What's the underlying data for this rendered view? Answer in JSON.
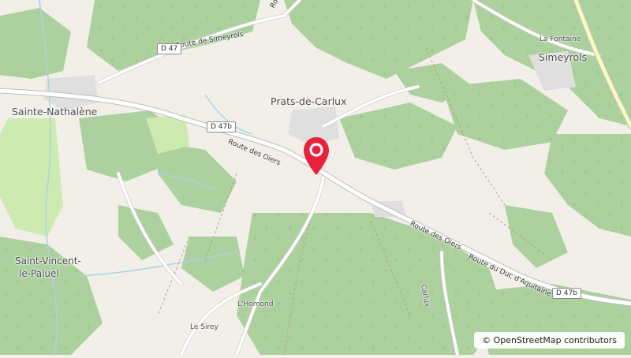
{
  "map": {
    "place_labels": {
      "prats": "Prats-de-Carlux",
      "sainte_nathalene": "Sainte-Nathalène",
      "simeyrols": "Simeyrols",
      "la_fontaine": "La Fontaine",
      "saint_vincent_1": "Saint-Vincent-",
      "saint_vincent_2": "le-Paluel",
      "lhomond": "L'Homond",
      "le_sirey": "Le Sirey",
      "carlux": "Carlux"
    },
    "road_labels": {
      "route_simeyrols": "Route de Simeyrols",
      "route_oiers_1": "Route des Oiers",
      "route_oiers_2": "Route des Oiers",
      "route_duc": "Route du Duc d'Aquitaine",
      "route_top": "Route"
    },
    "road_shields": {
      "d47": "D 47",
      "d47b_1": "D 47b",
      "d47b_2": "D 47b"
    },
    "marker": {
      "color": "#e8213f"
    },
    "attribution": {
      "symbol": "©",
      "text": "OpenStreetMap contributors"
    }
  }
}
